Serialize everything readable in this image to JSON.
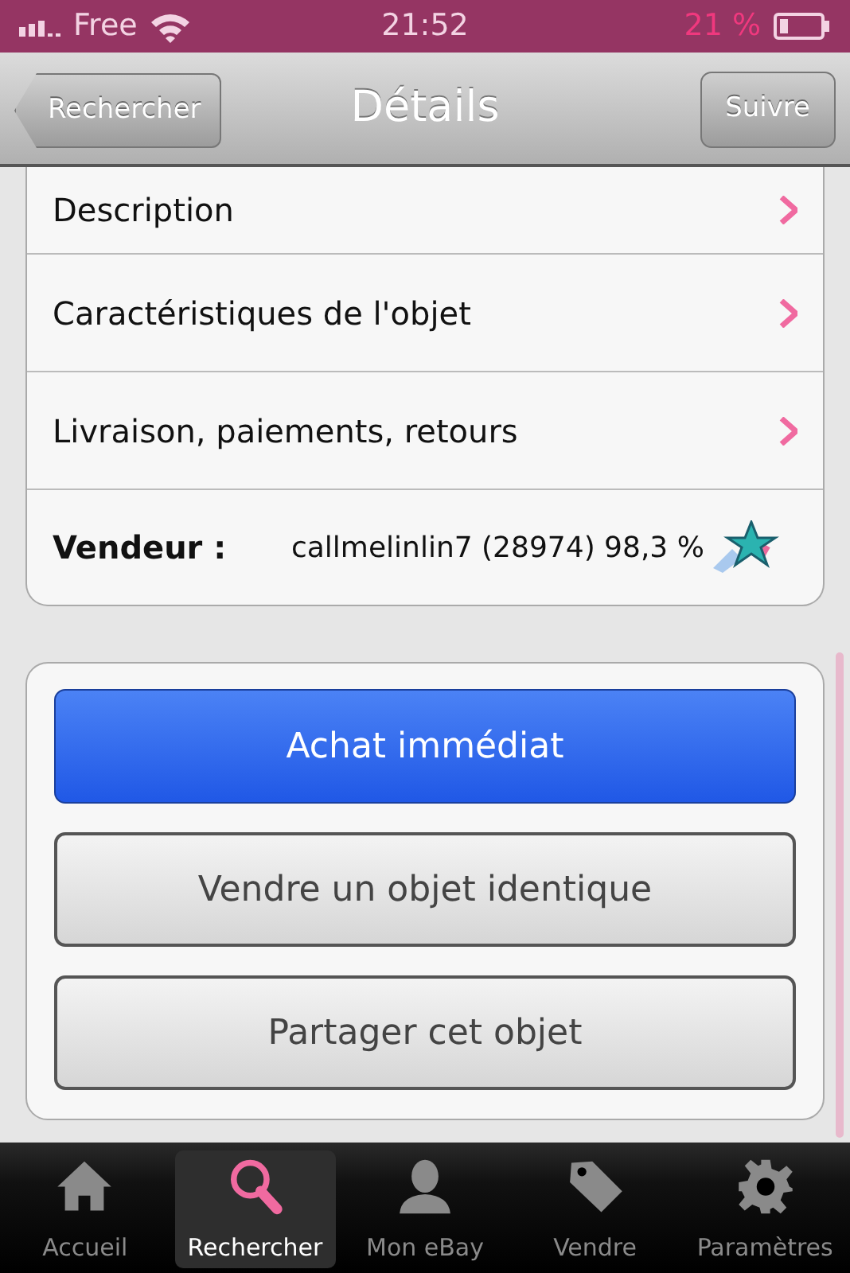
{
  "status_bar": {
    "carrier": "Free",
    "time": "21:52",
    "battery": "21 %"
  },
  "nav_bar": {
    "back": "Rechercher",
    "title": "Détails",
    "action": "Suivre"
  },
  "detail_rows": [
    {
      "label": "Description"
    },
    {
      "label": "Caractéristiques de l'objet"
    },
    {
      "label": "Livraison, paiements, retours"
    }
  ],
  "seller": {
    "label": "Vendeur :",
    "value": "callmelinlin7 (28974) 98,3 %"
  },
  "buttons": [
    {
      "label": "Achat immédiat",
      "kind": "primary"
    },
    {
      "label": "Vendre un objet identique",
      "kind": "secondary"
    },
    {
      "label": "Partager cet objet",
      "kind": "secondary"
    }
  ],
  "tabs": [
    {
      "label": "Accueil",
      "kind": "home",
      "selected": false
    },
    {
      "label": "Rechercher",
      "kind": "search",
      "selected": true
    },
    {
      "label": "Mon eBay",
      "kind": "person",
      "selected": false
    },
    {
      "label": "Vendre",
      "kind": "tag",
      "selected": false
    },
    {
      "label": "Paramètres",
      "kind": "gear",
      "selected": false
    }
  ]
}
